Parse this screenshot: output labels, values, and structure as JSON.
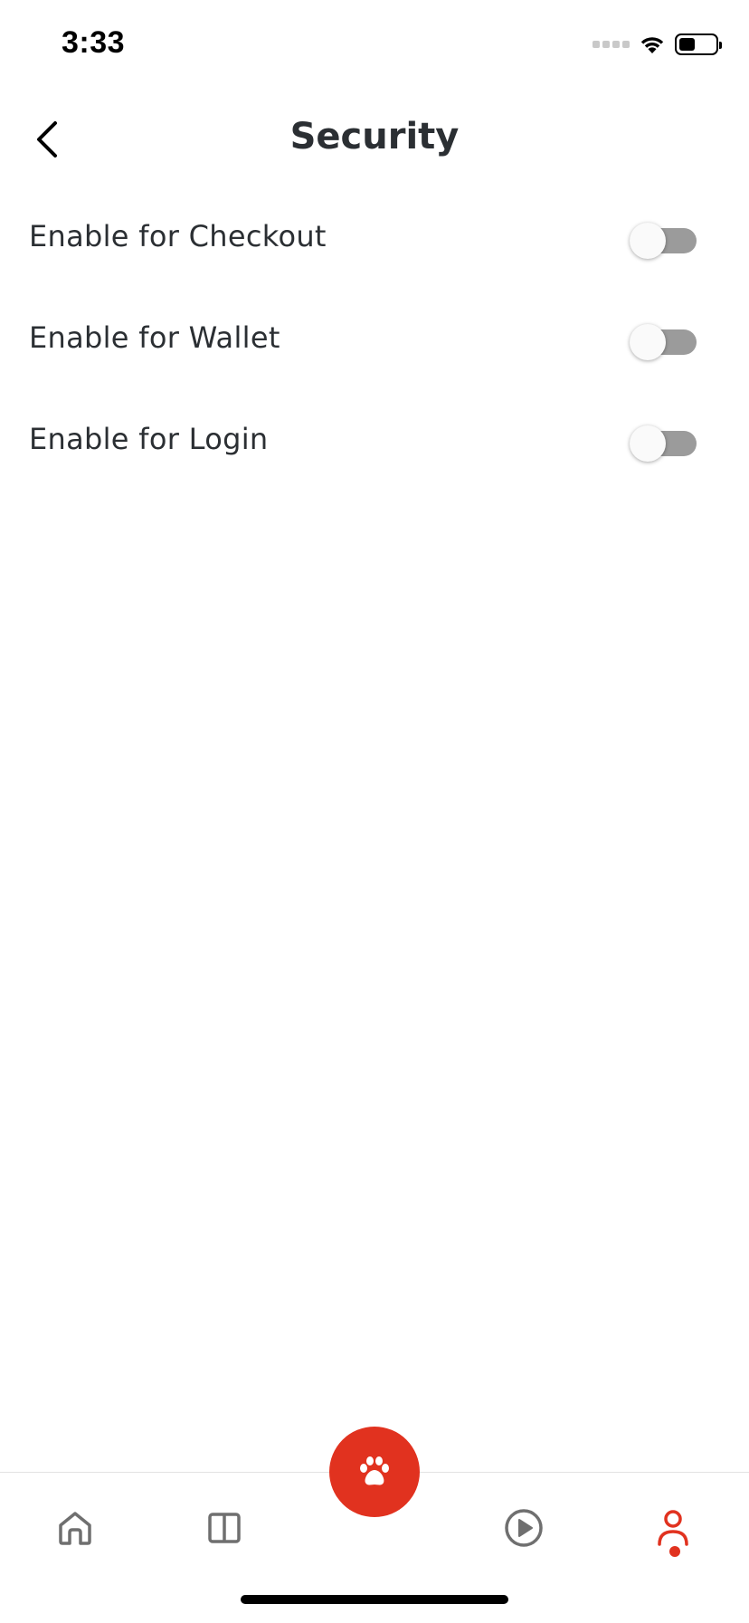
{
  "status_bar": {
    "time": "3:33",
    "battery_level": 0.45,
    "icons": [
      "cellular-signal-icon",
      "wifi-icon",
      "battery-icon"
    ]
  },
  "header": {
    "title": "Security",
    "back_icon": "chevron-left-icon"
  },
  "settings": [
    {
      "label": "Enable for Checkout",
      "enabled": false
    },
    {
      "label": "Enable for Wallet",
      "enabled": false
    },
    {
      "label": "Enable for Login",
      "enabled": false
    }
  ],
  "tab_bar": {
    "items": [
      {
        "icon": "home-icon",
        "active": false
      },
      {
        "icon": "book-icon",
        "active": false
      },
      {
        "icon": "paw-icon",
        "active": false
      },
      {
        "icon": "play-icon",
        "active": false
      },
      {
        "icon": "profile-icon",
        "active": true
      }
    ],
    "accent_color": "#e1321f",
    "inactive_color": "#6f6f6f"
  },
  "colors": {
    "text": "#2b2f33",
    "toggle_track_off": "#9b9b9b",
    "toggle_knob": "#fafafa"
  }
}
